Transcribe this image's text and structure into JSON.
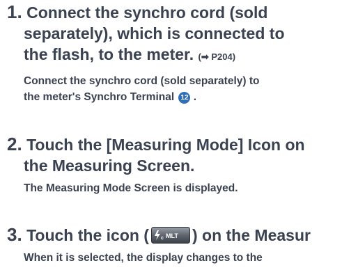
{
  "steps": [
    {
      "number": "1.",
      "lines": [
        "Connect the synchro cord (sold",
        "separately), which is connected to",
        "the flash, to the meter."
      ],
      "ref_arrow": "➡",
      "ref_page": "P204)",
      "ref_open": "(",
      "desc_lines": [
        "Connect the synchro cord (sold separately) to",
        "the meter's Synchro Terminal"
      ],
      "terminal_number": "12",
      "desc_end": "."
    },
    {
      "number": "2.",
      "lines": [
        "Touch the [Measuring Mode] Icon on",
        "the Measuring Screen."
      ],
      "desc_lines": [
        "The Measuring Mode Screen is displayed."
      ]
    },
    {
      "number": "3.",
      "line_prefix": "Touch the icon (",
      "line_suffix": ") on the Measur",
      "icon_name": "flash-cord-multi-icon",
      "icon_text": "MLT",
      "desc_lines": [
        "When it is selected, the display changes to the"
      ]
    }
  ]
}
